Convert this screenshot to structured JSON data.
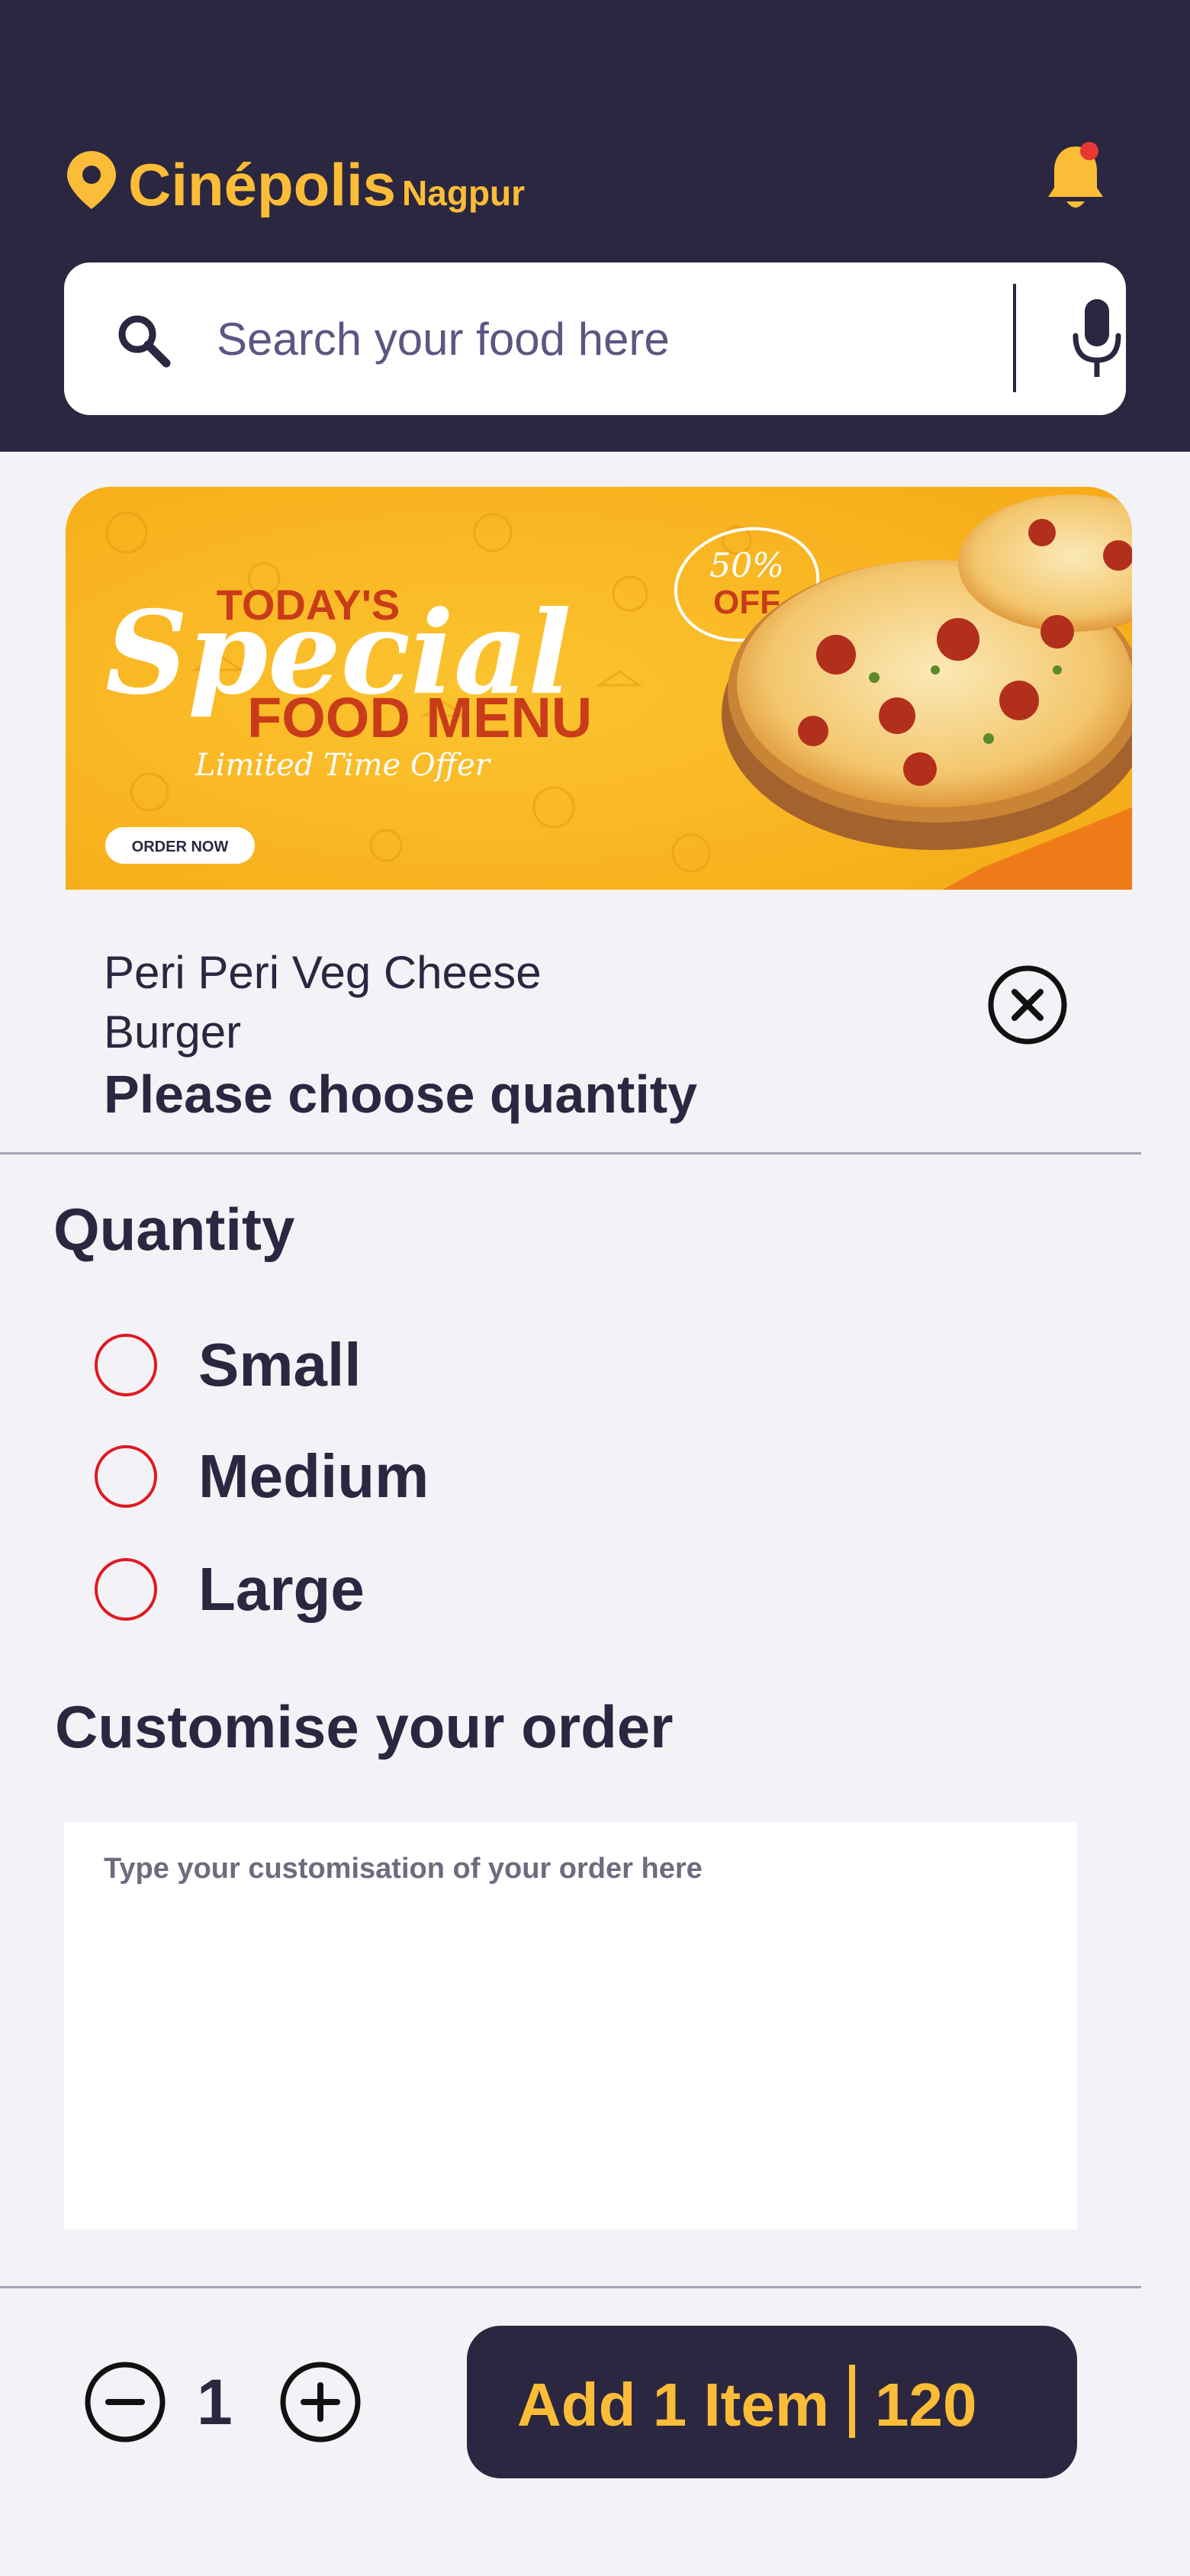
{
  "header": {
    "brand": "Cinépolis",
    "city": "Nagpur",
    "icons": {
      "location": "location-pin-icon",
      "notification": "bell-icon"
    },
    "notification_dot": true
  },
  "search": {
    "placeholder": "Search your food here",
    "icons": {
      "search": "search-icon",
      "voice": "mic-icon"
    }
  },
  "banner": {
    "title_line1": "TODAY'S",
    "title_script": "Special",
    "title_line2": "FOOD MENU",
    "tagline": "Limited Time Offer",
    "badge_top": "50%",
    "badge_bottom": "OFF",
    "cta": "ORDER NOW"
  },
  "item": {
    "name": "Peri Peri Veg Cheese Burger",
    "subtitle": "Please choose quantity"
  },
  "quantity": {
    "title": "Quantity",
    "options": [
      {
        "label": "Small",
        "selected": false
      },
      {
        "label": "Medium",
        "selected": false
      },
      {
        "label": "Large",
        "selected": false
      }
    ]
  },
  "customise": {
    "title": "Customise your order",
    "placeholder": "Type your customisation of your order here"
  },
  "footer": {
    "count": "1",
    "add_label": "Add 1 Item",
    "price": "120"
  },
  "colors": {
    "primary": "#2b2740",
    "accent": "#fbbd37",
    "radio": "#e0191f",
    "background": "#f3f2f7",
    "notification_dot": "#e53935"
  }
}
